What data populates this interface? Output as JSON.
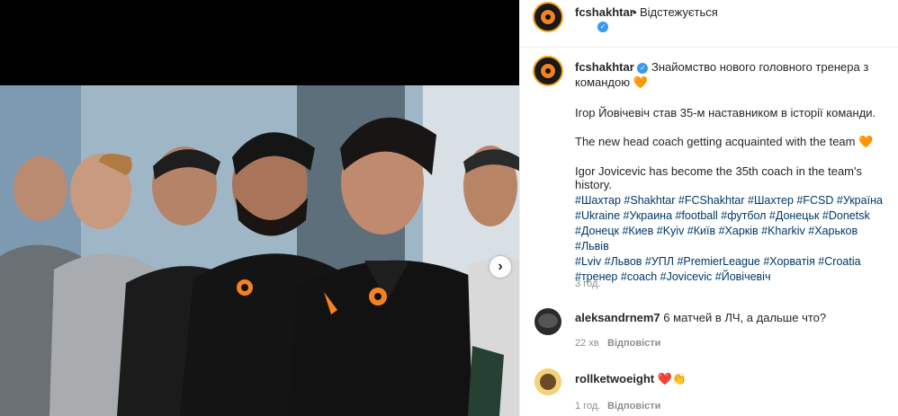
{
  "post": {
    "username": "fcshakhtar",
    "dot": "•",
    "follow_status": "Відстежується",
    "caption_title": "Знайомство нового головного тренера з командою",
    "caption_heart": "🧡",
    "para1": "Ігор Йовічевіч став 35-м наставником в історії команди.",
    "para2": "The new head coach getting acquainted with the team",
    "para2_heart": "🧡",
    "para3": "Igor Jovicevic has become the 35th coach in the team's history.",
    "hashtag_lines": [
      "#Шахтар #Shakhtar #FCShakhtar #Шахтер #FCSD #Україна",
      "#Ukraine #Украина #football #футбол #Донецьк #Donetsk",
      "#Донецк #Киев #Kyiv #Київ #Харків #Kharkiv #Харьков #Львів",
      "#Lviv #Львов #УПЛ #PremierLeague #Хорватія #Croatia",
      "#тренер #coach #Jovicevic #Йовічевіч"
    ],
    "time": "3 год."
  },
  "comments": [
    {
      "username": "aleksandrnem7",
      "text": "6 матчей в ЛЧ, а дальше что?",
      "time": "22 хв",
      "reply": "Відповісти"
    },
    {
      "username": "rollketwoeight",
      "text": "❤️👏",
      "time": "1 год.",
      "reply": "Відповісти"
    }
  ],
  "icons": {
    "next": "chevron-right-icon",
    "verified": "verified-badge-icon"
  },
  "colors": {
    "hashtag": "#00376b",
    "verified": "#3897f0",
    "brand_orange": "#f58220"
  }
}
